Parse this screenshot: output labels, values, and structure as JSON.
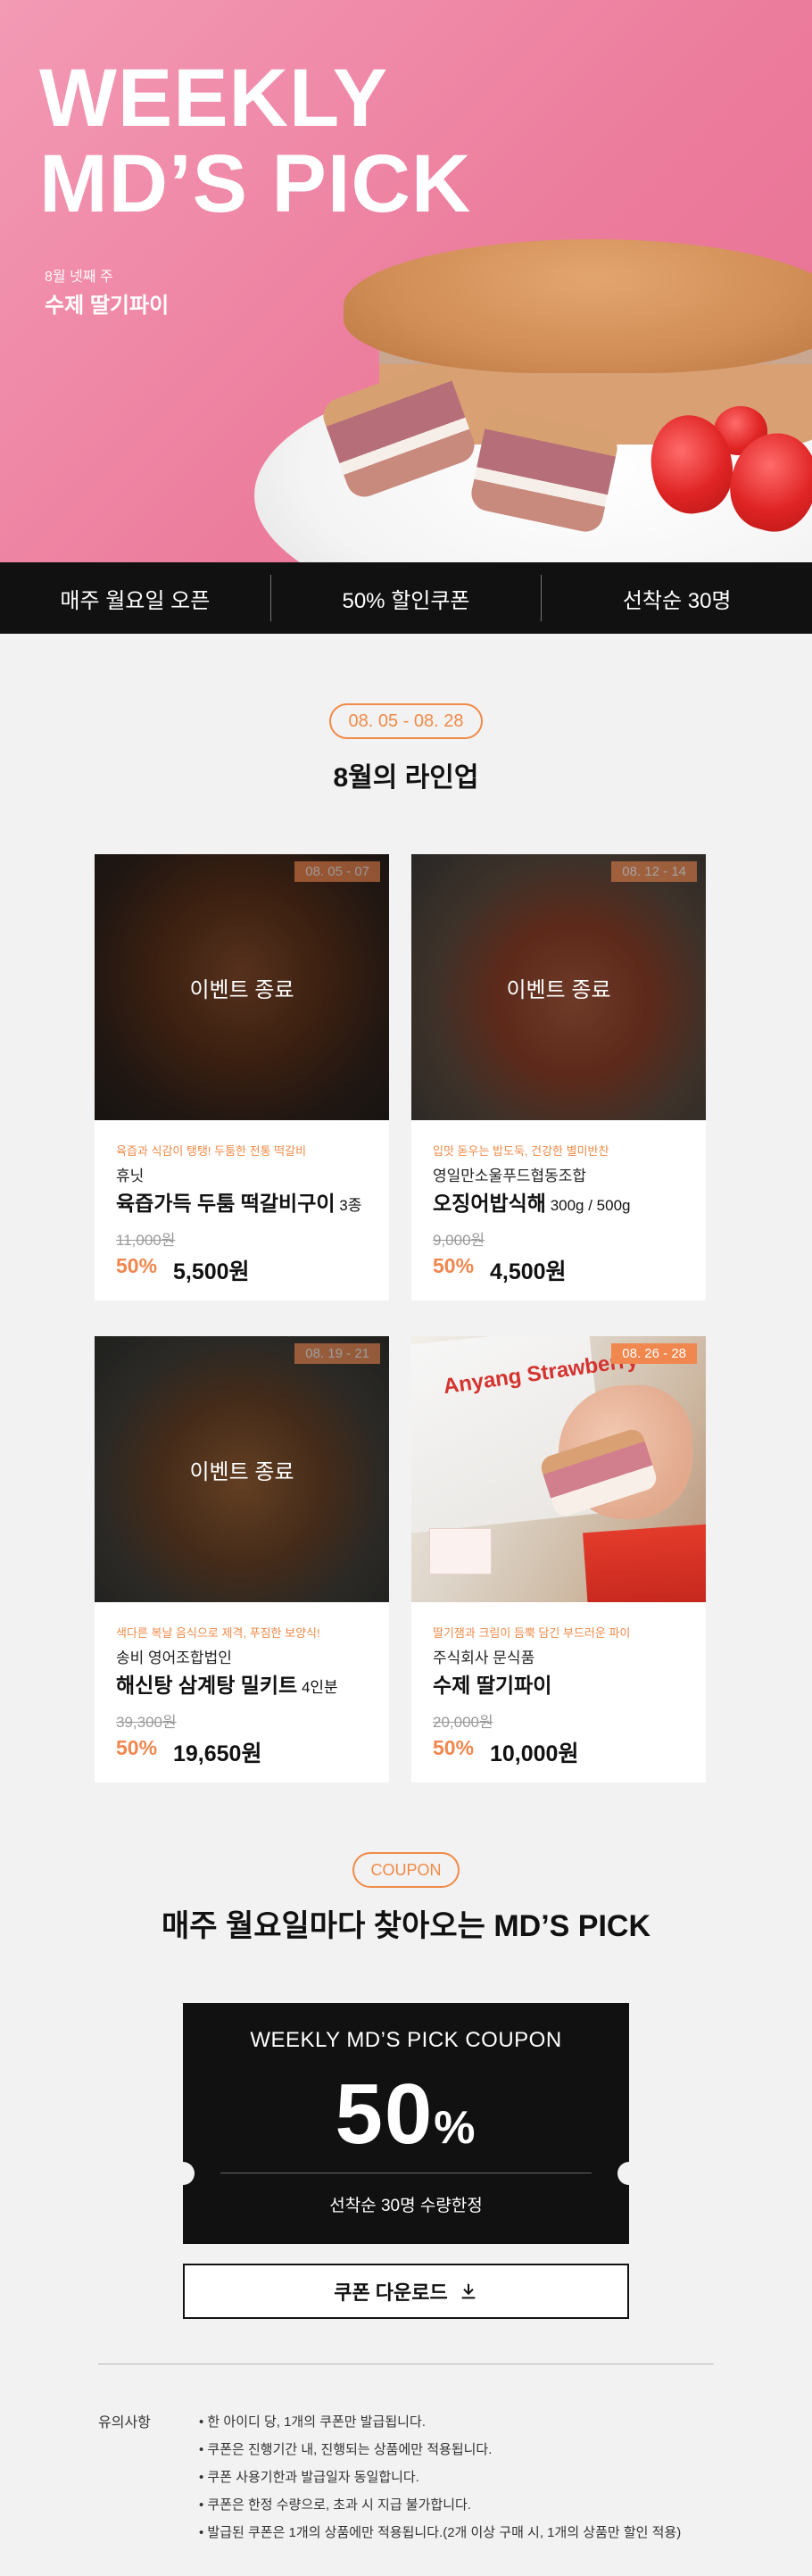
{
  "hero": {
    "title_line1": "WEEKLY",
    "title_line2": "MD’S PICK",
    "week": "8월 넷째 주",
    "product": "수제 딸기파이"
  },
  "info_bar": [
    "매주 월요일 오픈",
    "50% 할인쿠폰",
    "선착순 30명"
  ],
  "lineup": {
    "dates": "08. 05 - 08. 28",
    "title": "8월의 라인업",
    "ended_label": "이벤트 종료",
    "cards": [
      {
        "date": "08. 05 - 07",
        "tag": "육즙과 식감이 탱탱! 두툼한 전통 떡갈비",
        "maker": "휴닛",
        "name": "육즙가득 두툼 떡갈비구이",
        "option": " 3종",
        "original": "11,000원",
        "rate": "50%",
        "price": "5,500원",
        "ended": true
      },
      {
        "date": "08. 12 - 14",
        "tag": "입맛 돋우는 밥도둑, 건강한 별미반찬",
        "maker": "영일만소울푸드협동조합",
        "name": "오징어밥식해",
        "option": " 300g / 500g",
        "original": "9,000원",
        "rate": "50%",
        "price": "4,500원",
        "ended": true
      },
      {
        "date": "08. 19 - 21",
        "tag": "색다른 복날 음식으로 제격, 푸짐한 보양식!",
        "maker": "송비 영어조합법인",
        "name": "해신탕 삼계탕 밀키트",
        "option": " 4인분",
        "original": "39,300원",
        "rate": "50%",
        "price": "19,650원",
        "ended": true
      },
      {
        "date": "08. 26 - 28",
        "tag": "딸기잼과 크림이 듬뿍 담긴 부드러운 파이",
        "maker": "주식회사 문식품",
        "name": "수제 딸기파이",
        "option": "",
        "original": "20,000원",
        "rate": "50%",
        "price": "10,000원",
        "ended": false,
        "image_text": "Anyang Strawberry"
      }
    ]
  },
  "coupon": {
    "badge": "COUPON",
    "title": "매주 월요일마다 찾아오는 MD’S PICK",
    "ticket_title": "WEEKLY MD’S PICK COUPON",
    "ticket_value": "50",
    "ticket_unit": "%",
    "ticket_note": "선착순 30명 수량한정",
    "download_label": "쿠폰 다운로드",
    "download_icon": "download-icon"
  },
  "notice": {
    "label": "유의사항",
    "items": [
      "한 아이디 당, 1개의 쿠폰만 발급됩니다.",
      "쿠폰은 진행기간 내, 진행되는 상품에만 적용됩니다.",
      "쿠폰 사용기한과 발급일자 동일합니다.",
      "쿠폰은 한정 수량으로, 초과 시 지급 불가합니다.",
      "발급된 쿠폰은 1개의 상품에만 적용됩니다.(2개 이상 구매 시, 1개의 상품만 할인 적용)"
    ]
  },
  "colors": {
    "accent": "#f0874e",
    "hero_pink": "#ec7d9d",
    "dark": "#111111",
    "background": "#f2f2f2"
  }
}
